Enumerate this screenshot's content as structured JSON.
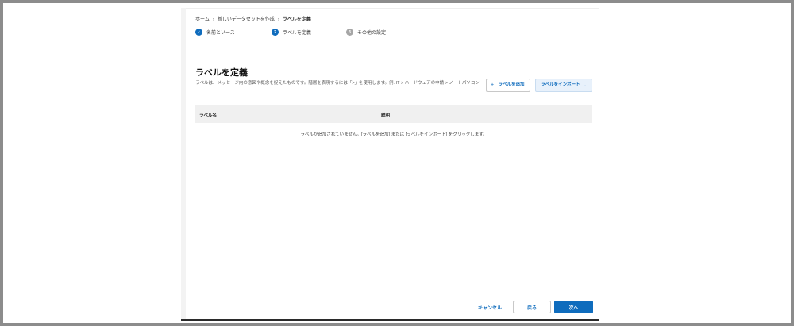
{
  "breadcrumb": {
    "home": "ホーム",
    "new_dataset": "新しいデータセットを作成",
    "current": "ラベルを定義",
    "separator": "›"
  },
  "stepper": {
    "steps": [
      {
        "label": "名前とソース",
        "state": "done",
        "marker": "✓"
      },
      {
        "label": "ラベルを定義",
        "state": "active",
        "marker": "2"
      },
      {
        "label": "その他の設定",
        "state": "todo",
        "marker": "3"
      }
    ]
  },
  "main": {
    "title": "ラベルを定義",
    "description": "ラベルは、メッセージ内の意図や概念を捉えたものです。階層を表現するには「>」を使用します。例: IT > ハードウェアの申請 > ノートパソコン",
    "add_label_button": "ラベルを追加",
    "add_label_icon": "plus-icon",
    "import_label_button": "ラベルをインポート",
    "import_label_icon": "chevron-down-icon"
  },
  "table": {
    "columns": [
      "ラベル名",
      "説明"
    ],
    "empty_message": "ラベルが追加されていません。[ラベルを追加] または [ラベルをインポート] をクリックします。"
  },
  "footer": {
    "cancel": "キャンセル",
    "back": "戻る",
    "next": "次へ"
  },
  "colors": {
    "accent": "#0f6cbd",
    "inactive_step": "#a6a6a6",
    "table_header_bg": "#f0f0f0"
  }
}
